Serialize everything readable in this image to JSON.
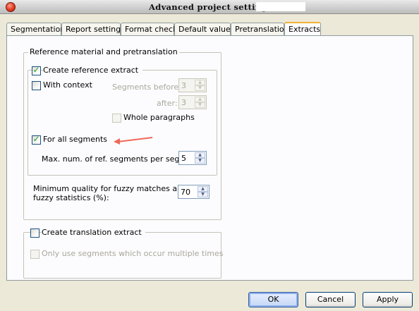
{
  "window": {
    "title": "Advanced project settings:"
  },
  "tabs": [
    {
      "label": "Segmentation"
    },
    {
      "label": "Report settings"
    },
    {
      "label": "Format check"
    },
    {
      "label": "Default values"
    },
    {
      "label": "Pretranslation"
    },
    {
      "label": "Extracts"
    }
  ],
  "active_tab": "Extracts",
  "reference_group": {
    "legend": "Reference material and pretranslation",
    "create_reference_extract": {
      "label": "Create reference extract",
      "checked": true
    },
    "with_context": {
      "label": "With context",
      "checked": false
    },
    "segments_before": {
      "label": "Segments before:",
      "value": "3"
    },
    "segments_after": {
      "label": "after:",
      "value": "3"
    },
    "whole_paragraphs": {
      "label": "Whole paragraphs",
      "checked": false
    },
    "for_all_segments": {
      "label": "For all segments",
      "checked": true
    },
    "max_ref_segments": {
      "label": "Max. num. of ref. segments per segment:",
      "value": "5"
    },
    "min_quality": {
      "label_line1": "Minimum quality for fuzzy matches and",
      "label_line2": "fuzzy statistics (%):",
      "value": "70"
    }
  },
  "translation_group": {
    "create_translation_extract": {
      "label": "Create translation extract",
      "checked": false
    },
    "only_multiple": {
      "label": "Only use segments which occur multiple times",
      "checked": false
    }
  },
  "buttons": {
    "ok": "OK",
    "cancel": "Cancel",
    "apply": "Apply"
  },
  "colors": {
    "accent_arrow": "#f0685a",
    "tab_highlight": "#f1b235",
    "check_mark": "#21a121"
  }
}
